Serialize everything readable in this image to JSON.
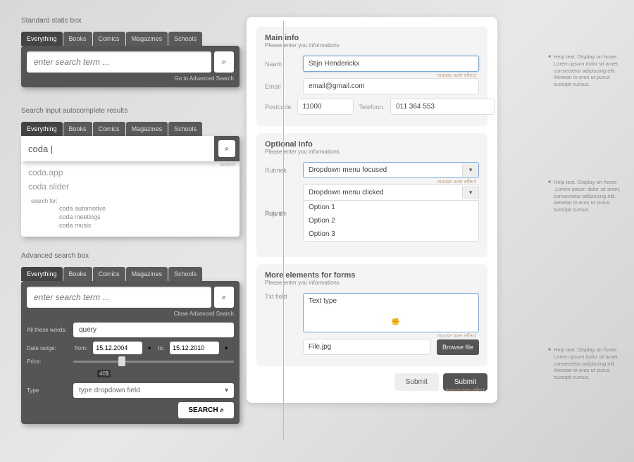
{
  "sections": {
    "static_title": "Standard static box",
    "autocomplete_title": "Search input autocomplete results",
    "advanced_title": "Advanced search box"
  },
  "tabs": [
    "Everything",
    "Books",
    "Comics",
    "Magazines",
    "Schools"
  ],
  "search": {
    "placeholder": "enter search term ...",
    "go_advanced": "Go to Advanced Search",
    "close_advanced": "Close Advanced Search",
    "search_label": "Search",
    "search_button": "SEARCH"
  },
  "autocomplete": {
    "value": "coda |",
    "items": [
      "coda.app",
      "coda slider"
    ],
    "search_for_label": "search for:",
    "subitems": [
      "coda automotive",
      "coda meetings",
      "coda music"
    ]
  },
  "advanced": {
    "all_words_label": "All these words:",
    "all_words_value": "query",
    "date_label": "Date range:",
    "from": "from:",
    "to": "to:",
    "date_from": "15.12.2004",
    "date_to": "15.12.2010",
    "price_label": "Price:",
    "price_val": "40$",
    "type_label": "Type",
    "type_value": "type dropdown field"
  },
  "form": {
    "main": {
      "title": "Main info",
      "subtitle": "Please enter you informations",
      "naam_label": "Naam",
      "naam_value": "Stijn Henderickx",
      "email_label": "Email",
      "email_value": "email@gmail.com",
      "postcode_label": "Postcode",
      "postcode_value": "11000",
      "telefoon_label": "Telefoon.",
      "telefoon_value": "011 364 553",
      "mouse_over": "mouse over effect"
    },
    "optional": {
      "title": "Optional info",
      "subtitle": "Please enter you informations",
      "rubriek_label": "Rubriek",
      "dd_focused": "Dropdown menu focused",
      "dd_clicked": "Dropdown menu clicked",
      "options": [
        "Option 1",
        "Option 2",
        "Option 3"
      ],
      "prijs_label": "Prijs €"
    },
    "more": {
      "title": "More elements for forms",
      "subtitle": "Please enter you informations",
      "txt_label": "Txt field",
      "txt_value": "Text type",
      "file_value": "File.jpg",
      "browse": "Browse file",
      "submit": "Submit"
    }
  },
  "help": {
    "text1": "Help text. Display on hover . Lorem ipsum dolor sit amet, consectetur adipiscing elit. Aenean in eros ut purus suscipit cursus.",
    "text2": "Help text. Display on hover .Lorem ipsum dolor sit amet, consectetur adipiscing elit. Aenean in eros ut purus suscipit cursus.",
    "text3": "Help text. Display on hover . Lorem ipsum dolor sit amet, consectetur adipiscing elit. Aenean in eros ut purus suscipit cursus."
  }
}
